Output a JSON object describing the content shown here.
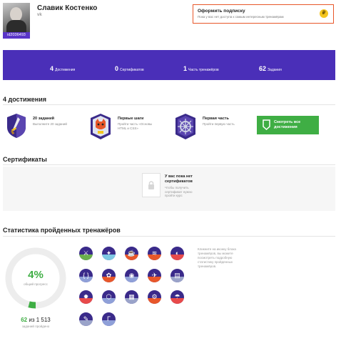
{
  "profile": {
    "name": "Славик Костенко",
    "social": "vk",
    "user_id": "id2036493",
    "avatar_icon": "user-photo"
  },
  "subscription": {
    "title": "Оформить подписку",
    "description": "Пока у вас нет доступа к самым интересным тренажёрам",
    "coin_symbol": "₽",
    "border_color": "#e8572a"
  },
  "stats": [
    {
      "value": "4",
      "label": "Достижения"
    },
    {
      "value": "0",
      "label": "Сертификатов"
    },
    {
      "value": "1",
      "label": "Часть тренажёров"
    },
    {
      "value": "62",
      "label": "Задания"
    }
  ],
  "stats_bar_color": "#4a2fb8",
  "achievements": {
    "heading": "4 достижения",
    "items": [
      {
        "title": "20 заданий",
        "desc": "Выполните 20 заданий",
        "icon": "sword-badge-icon"
      },
      {
        "title": "Первые шаги",
        "desc": "Пройти часть «Основы HTML и CSS»",
        "icon": "fox-rocket-badge-icon"
      },
      {
        "title": "Первая часть",
        "desc": "Пройти первую часть",
        "icon": "ship-wheel-badge-icon"
      }
    ],
    "all_button": "Смотреть все достижения",
    "button_color": "#3fae44"
  },
  "certificates": {
    "heading": "Сертификаты",
    "empty_title": "У вас пока нет сертификатов",
    "empty_desc": "Чтобы получить сертификат нужно пройти курс",
    "doc_icon": "certificate-lock-icon"
  },
  "trainers": {
    "heading": "Статистика пройденных тренажёров",
    "percent": "4%",
    "percent_label": "общий прогресс",
    "done": "62",
    "count_sep": "из",
    "total": "1 513",
    "count_label": "заданий пройдено",
    "progress_fraction": 0.04,
    "hint": "Кликните на иконку блока тренажёров, вы можете посмотреть подробную статистику пройденных тренажёров.",
    "icons": [
      "trainer-icon-1",
      "trainer-icon-2",
      "trainer-icon-3",
      "trainer-icon-4",
      "trainer-icon-5",
      "trainer-icon-6",
      "trainer-icon-7",
      "trainer-icon-8",
      "trainer-icon-9",
      "trainer-icon-10",
      "trainer-icon-11",
      "trainer-icon-12",
      "trainer-icon-13",
      "trainer-icon-14",
      "trainer-icon-15",
      "trainer-icon-16",
      "trainer-icon-17"
    ]
  }
}
